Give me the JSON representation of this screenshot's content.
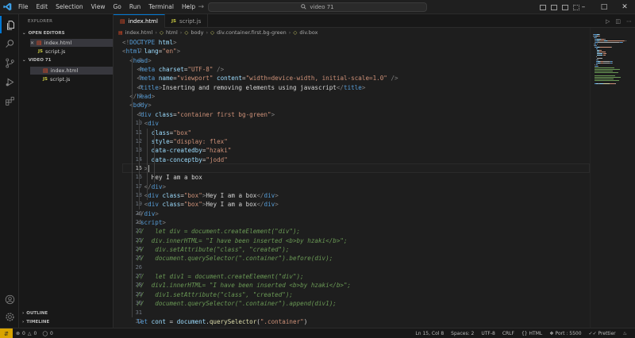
{
  "menu": [
    "File",
    "Edit",
    "Selection",
    "View",
    "Go",
    "Run",
    "Terminal",
    "Help"
  ],
  "command_center": "video 71",
  "sidebar": {
    "title": "EXPLORER",
    "open_editors_label": "OPEN EDITORS",
    "open_editors": [
      {
        "name": "index.html",
        "type": "html"
      },
      {
        "name": "script.js",
        "type": "js"
      }
    ],
    "folder_label": "VIDEO 71",
    "files": [
      {
        "name": "index.html",
        "type": "html"
      },
      {
        "name": "script.js",
        "type": "js"
      }
    ],
    "outline_label": "OUTLINE",
    "timeline_label": "TIMELINE"
  },
  "tabs": [
    {
      "label": "index.html",
      "type": "html"
    },
    {
      "label": "script.js",
      "type": "js"
    }
  ],
  "breadcrumb": [
    "index.html",
    "html",
    "body",
    "div.container.first.bg-green",
    "div.box"
  ],
  "editor": {
    "current_line": 15,
    "lines": [
      {
        "n": 1,
        "indent": 0,
        "segs": [
          [
            "ang",
            "<!"
          ],
          [
            "t",
            "DOCTYPE"
          ],
          [
            "at",
            " html"
          ],
          [
            "ang",
            ">"
          ]
        ]
      },
      {
        "n": 2,
        "indent": 0,
        "segs": [
          [
            "ang",
            "<"
          ],
          [
            "t",
            "html"
          ],
          [
            "at",
            " lang"
          ],
          [
            "d",
            "="
          ],
          [
            "st",
            "\"en\""
          ],
          [
            "ang",
            ">"
          ]
        ]
      },
      {
        "n": 3,
        "indent": 1,
        "segs": [
          [
            "ang",
            "<"
          ],
          [
            "t",
            "head"
          ],
          [
            "ang",
            ">"
          ]
        ]
      },
      {
        "n": 4,
        "indent": 2,
        "segs": [
          [
            "ang",
            "<"
          ],
          [
            "t",
            "meta"
          ],
          [
            "at",
            " charset"
          ],
          [
            "d",
            "="
          ],
          [
            "st",
            "\"UTF-8\""
          ],
          [
            "ang",
            " />"
          ]
        ]
      },
      {
        "n": 5,
        "indent": 2,
        "segs": [
          [
            "ang",
            "<"
          ],
          [
            "t",
            "meta"
          ],
          [
            "at",
            " name"
          ],
          [
            "d",
            "="
          ],
          [
            "st",
            "\"viewport\""
          ],
          [
            "at",
            " content"
          ],
          [
            "d",
            "="
          ],
          [
            "st",
            "\"width=device-width, initial-scale=1.0\""
          ],
          [
            "ang",
            " />"
          ]
        ]
      },
      {
        "n": 6,
        "indent": 2,
        "segs": [
          [
            "ang",
            "<"
          ],
          [
            "t",
            "title"
          ],
          [
            "ang",
            ">"
          ],
          [
            "d",
            "Inserting and removing elements using javascript"
          ],
          [
            "ang",
            "</"
          ],
          [
            "t",
            "title"
          ],
          [
            "ang",
            ">"
          ]
        ]
      },
      {
        "n": 7,
        "indent": 1,
        "segs": [
          [
            "ang",
            "</"
          ],
          [
            "t",
            "head"
          ],
          [
            "ang",
            ">"
          ]
        ]
      },
      {
        "n": 8,
        "indent": 1,
        "segs": [
          [
            "ang",
            "<"
          ],
          [
            "t",
            "body"
          ],
          [
            "ang",
            ">"
          ]
        ]
      },
      {
        "n": 9,
        "indent": 2,
        "segs": [
          [
            "ang",
            "<"
          ],
          [
            "t",
            "div"
          ],
          [
            "at",
            " class"
          ],
          [
            "d",
            "="
          ],
          [
            "st",
            "\"container first bg-green\""
          ],
          [
            "ang",
            ">"
          ]
        ]
      },
      {
        "n": 10,
        "indent": 3,
        "segs": [
          [
            "ang",
            "<"
          ],
          [
            "t",
            "div"
          ]
        ]
      },
      {
        "n": 11,
        "indent": 4,
        "segs": [
          [
            "at",
            "class"
          ],
          [
            "d",
            "="
          ],
          [
            "st",
            "\"box\""
          ]
        ]
      },
      {
        "n": 12,
        "indent": 4,
        "segs": [
          [
            "at",
            "style"
          ],
          [
            "d",
            "="
          ],
          [
            "st",
            "\"display: flex\""
          ]
        ]
      },
      {
        "n": 13,
        "indent": 4,
        "segs": [
          [
            "at",
            "data-createdby"
          ],
          [
            "d",
            "="
          ],
          [
            "st",
            "\"hzaki\""
          ]
        ]
      },
      {
        "n": 14,
        "indent": 4,
        "segs": [
          [
            "at",
            "data-conceptby"
          ],
          [
            "d",
            "="
          ],
          [
            "st",
            "\"jodd\""
          ]
        ]
      },
      {
        "n": 15,
        "indent": 3,
        "segs": [
          [
            "ang",
            ">"
          ]
        ]
      },
      {
        "n": 16,
        "indent": 4,
        "segs": [
          [
            "d",
            "Hey I am a box"
          ]
        ]
      },
      {
        "n": 17,
        "indent": 3,
        "segs": [
          [
            "ang",
            "</"
          ],
          [
            "t",
            "div"
          ],
          [
            "ang",
            ">"
          ]
        ]
      },
      {
        "n": 18,
        "indent": 3,
        "segs": [
          [
            "ang",
            "<"
          ],
          [
            "t",
            "div"
          ],
          [
            "at",
            " class"
          ],
          [
            "d",
            "="
          ],
          [
            "st",
            "\"box\""
          ],
          [
            "ang",
            ">"
          ],
          [
            "d",
            "Hey I am a box"
          ],
          [
            "ang",
            "</"
          ],
          [
            "t",
            "div"
          ],
          [
            "ang",
            ">"
          ]
        ]
      },
      {
        "n": 19,
        "indent": 3,
        "segs": [
          [
            "ang",
            "<"
          ],
          [
            "t",
            "div"
          ],
          [
            "at",
            " class"
          ],
          [
            "d",
            "="
          ],
          [
            "st",
            "\"box\""
          ],
          [
            "ang",
            ">"
          ],
          [
            "d",
            "Hey I am a box"
          ],
          [
            "ang",
            "</"
          ],
          [
            "t",
            "div"
          ],
          [
            "ang",
            ">"
          ]
        ]
      },
      {
        "n": 20,
        "indent": 2,
        "segs": [
          [
            "ang",
            "</"
          ],
          [
            "t",
            "div"
          ],
          [
            "ang",
            ">"
          ]
        ]
      },
      {
        "n": 21,
        "indent": 2,
        "segs": [
          [
            "ang",
            "<"
          ],
          [
            "t",
            "script"
          ],
          [
            "ang",
            ">"
          ]
        ]
      },
      {
        "n": 22,
        "indent": 2,
        "segs": [
          [
            "cm",
            "//   let div = document.createElement(\"div\");"
          ]
        ]
      },
      {
        "n": 23,
        "indent": 2,
        "segs": [
          [
            "cm",
            "//  div.innerHTML= \"I have been inserted <b>by hzaki</b>\";"
          ]
        ]
      },
      {
        "n": 24,
        "indent": 2,
        "segs": [
          [
            "cm",
            "//   div.setAttribute(\"class\", \"created\");"
          ]
        ]
      },
      {
        "n": 25,
        "indent": 2,
        "segs": [
          [
            "cm",
            "//   document.querySelector(\".container\").before(div);"
          ]
        ]
      },
      {
        "n": 26,
        "indent": 2,
        "segs": []
      },
      {
        "n": 27,
        "indent": 2,
        "segs": [
          [
            "cm",
            "//   let div1 = document.createElement(\"div\");"
          ]
        ]
      },
      {
        "n": 28,
        "indent": 2,
        "segs": [
          [
            "cm",
            "//  div1.innerHTML= \"I have been inserted <b>by hzaki</b>\";"
          ]
        ]
      },
      {
        "n": 29,
        "indent": 2,
        "segs": [
          [
            "cm",
            "//   div1.setAttribute(\"class\", \"created\");"
          ]
        ]
      },
      {
        "n": 30,
        "indent": 2,
        "segs": [
          [
            "cm",
            "//   document.querySelector(\".container\").append(div1);"
          ]
        ]
      },
      {
        "n": 31,
        "indent": 2,
        "segs": []
      },
      {
        "n": 32,
        "indent": 2,
        "segs": [
          [
            "kw",
            "let"
          ],
          [
            "vr",
            " cont"
          ],
          [
            "d",
            " = "
          ],
          [
            "vr",
            "document"
          ],
          [
            "d",
            "."
          ],
          [
            "fn",
            "querySelector"
          ],
          [
            "d",
            "("
          ],
          [
            "st",
            "\".container\""
          ],
          [
            "d",
            ")"
          ]
        ]
      }
    ]
  },
  "status": {
    "errors": "0",
    "warnings": "0",
    "ports": "0",
    "position": "Ln 15, Col 8",
    "spaces": "Spaces: 2",
    "encoding": "UTF-8",
    "eol": "CRLF",
    "language": "HTML",
    "live_port": "Port : 5500",
    "prettier": "Prettier"
  },
  "colors": {
    "accent": "#0078d4",
    "remote": "#d9a400",
    "html_icon": "#e44d26",
    "js_icon": "#cbcb41"
  }
}
